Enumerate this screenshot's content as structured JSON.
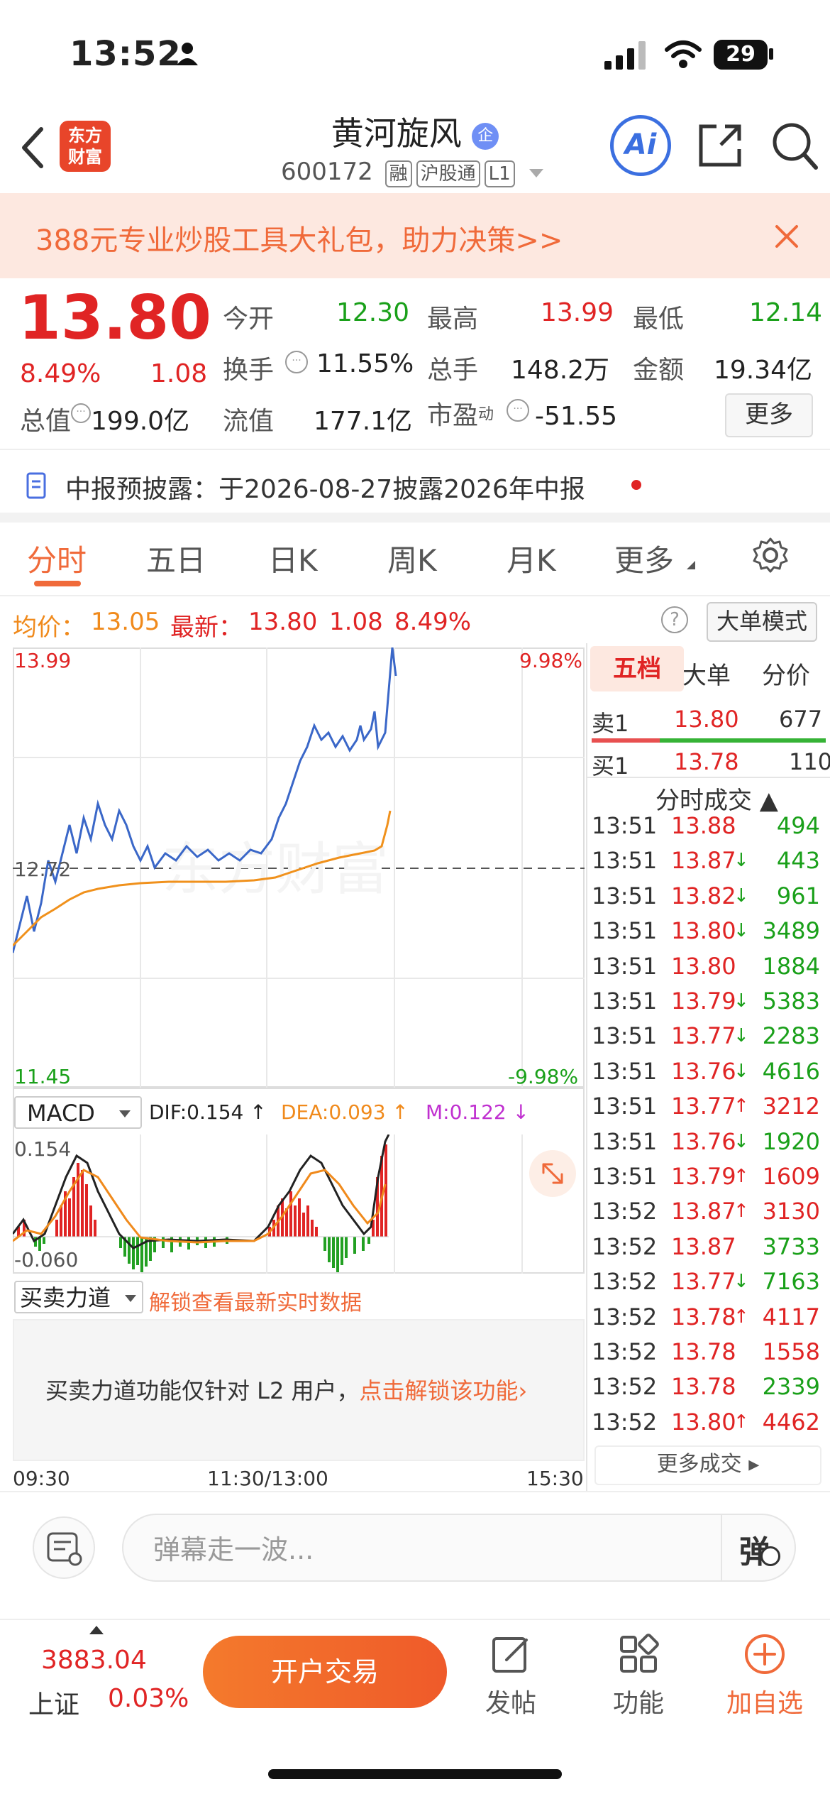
{
  "status": {
    "time": "13:52",
    "battery": "29"
  },
  "header": {
    "logo_line1": "东方",
    "logo_line2": "财富",
    "stock_name": "黄河旋风",
    "ent_badge": "企",
    "code": "600172",
    "tags": [
      "融",
      "沪股通",
      "L1"
    ],
    "ai": "Ai"
  },
  "banner": {
    "text": "388元专业炒股工具大礼包，助力决策>>"
  },
  "quote": {
    "price": "13.80",
    "pct": "8.49%",
    "change": "1.08",
    "open_label": "今开",
    "open": "12.30",
    "high_label": "最高",
    "high": "13.99",
    "low_label": "最低",
    "low": "12.14",
    "turnover_label": "换手",
    "turnover": "11.55%",
    "volume_label": "总手",
    "volume": "148.2万",
    "amount_label": "金额",
    "amount": "19.34亿",
    "mktcap_label": "总值",
    "mktcap": "199.0亿",
    "float_label": "流值",
    "float": "177.1亿",
    "pe_label": "市盈",
    "pe_sup": "动",
    "pe": "-51.55",
    "more": "更多"
  },
  "notice": {
    "text": "中报预披露：于2026-08-27披露2026年中报"
  },
  "tabs": [
    "分时",
    "五日",
    "日K",
    "周K",
    "月K",
    "更多"
  ],
  "info": {
    "avg_label": "均价：",
    "avg": "13.05",
    "latest_label": "最新：",
    "latest": "13.80",
    "chg": "1.08",
    "pct": "8.49%",
    "big_order": "大单模式"
  },
  "chart": {
    "y_high": "13.99",
    "y_mid": "12.72",
    "y_low": "11.45",
    "pct_high": "9.98%",
    "pct_low": "-9.98%",
    "x_start": "09:30",
    "x_mid": "11:30/13:00",
    "x_end": "15:30",
    "watermark": "东方财富"
  },
  "macd": {
    "selector": "MACD",
    "dif": "DIF:0.154 ↑",
    "dea": "DEA:0.093 ↑",
    "m": "M:0.122 ↓",
    "y_high": "0.154",
    "y_low": "-0.060"
  },
  "buysell": {
    "selector": "买卖力道",
    "unlock": "解锁查看最新实时数据",
    "panel_text": "买卖力道功能仅针对 L2 用户，",
    "panel_link": "点击解锁该功能›"
  },
  "right_panel": {
    "tabs": [
      "五档",
      "大单",
      "分价"
    ],
    "sell1": {
      "label": "卖1",
      "price": "13.80",
      "vol": "677"
    },
    "buy1": {
      "label": "买1",
      "price": "13.78",
      "vol": "110"
    },
    "trades_title": "分时成交 ▲",
    "trades": [
      {
        "t": "13:51",
        "p": "13.88",
        "arrow": "",
        "v": "494",
        "vc": "green"
      },
      {
        "t": "13:51",
        "p": "13.87",
        "arrow": "↓",
        "v": "443",
        "vc": "green"
      },
      {
        "t": "13:51",
        "p": "13.82",
        "arrow": "↓",
        "v": "961",
        "vc": "green"
      },
      {
        "t": "13:51",
        "p": "13.80",
        "arrow": "↓",
        "v": "3489",
        "vc": "green"
      },
      {
        "t": "13:51",
        "p": "13.80",
        "arrow": "",
        "v": "1884",
        "vc": "green"
      },
      {
        "t": "13:51",
        "p": "13.79",
        "arrow": "↓",
        "v": "5383",
        "vc": "green"
      },
      {
        "t": "13:51",
        "p": "13.77",
        "arrow": "↓",
        "v": "2283",
        "vc": "green"
      },
      {
        "t": "13:51",
        "p": "13.76",
        "arrow": "↓",
        "v": "4616",
        "vc": "green"
      },
      {
        "t": "13:51",
        "p": "13.77",
        "arrow": "↑",
        "v": "3212",
        "vc": "red"
      },
      {
        "t": "13:51",
        "p": "13.76",
        "arrow": "↓",
        "v": "1920",
        "vc": "green"
      },
      {
        "t": "13:51",
        "p": "13.79",
        "arrow": "↑",
        "v": "1609",
        "vc": "red"
      },
      {
        "t": "13:52",
        "p": "13.87",
        "arrow": "↑",
        "v": "3130",
        "vc": "red"
      },
      {
        "t": "13:52",
        "p": "13.87",
        "arrow": "",
        "v": "3733",
        "vc": "green"
      },
      {
        "t": "13:52",
        "p": "13.77",
        "arrow": "↓",
        "v": "7163",
        "vc": "green"
      },
      {
        "t": "13:52",
        "p": "13.78",
        "arrow": "↑",
        "v": "4117",
        "vc": "red"
      },
      {
        "t": "13:52",
        "p": "13.78",
        "arrow": "",
        "v": "1558",
        "vc": "red"
      },
      {
        "t": "13:52",
        "p": "13.78",
        "arrow": "",
        "v": "2339",
        "vc": "green"
      },
      {
        "t": "13:52",
        "p": "13.80",
        "arrow": "↑",
        "v": "4462",
        "vc": "red"
      }
    ],
    "more_trades": "更多成交 ▸"
  },
  "comment": {
    "placeholder": "弹幕走一波...",
    "danmu": "弹"
  },
  "bottom": {
    "index_value": "3883.04",
    "index_name": "上证",
    "index_pct": "0.03%",
    "open_account": "开户交易",
    "post": "发帖",
    "function": "功能",
    "add": "加自选"
  }
}
